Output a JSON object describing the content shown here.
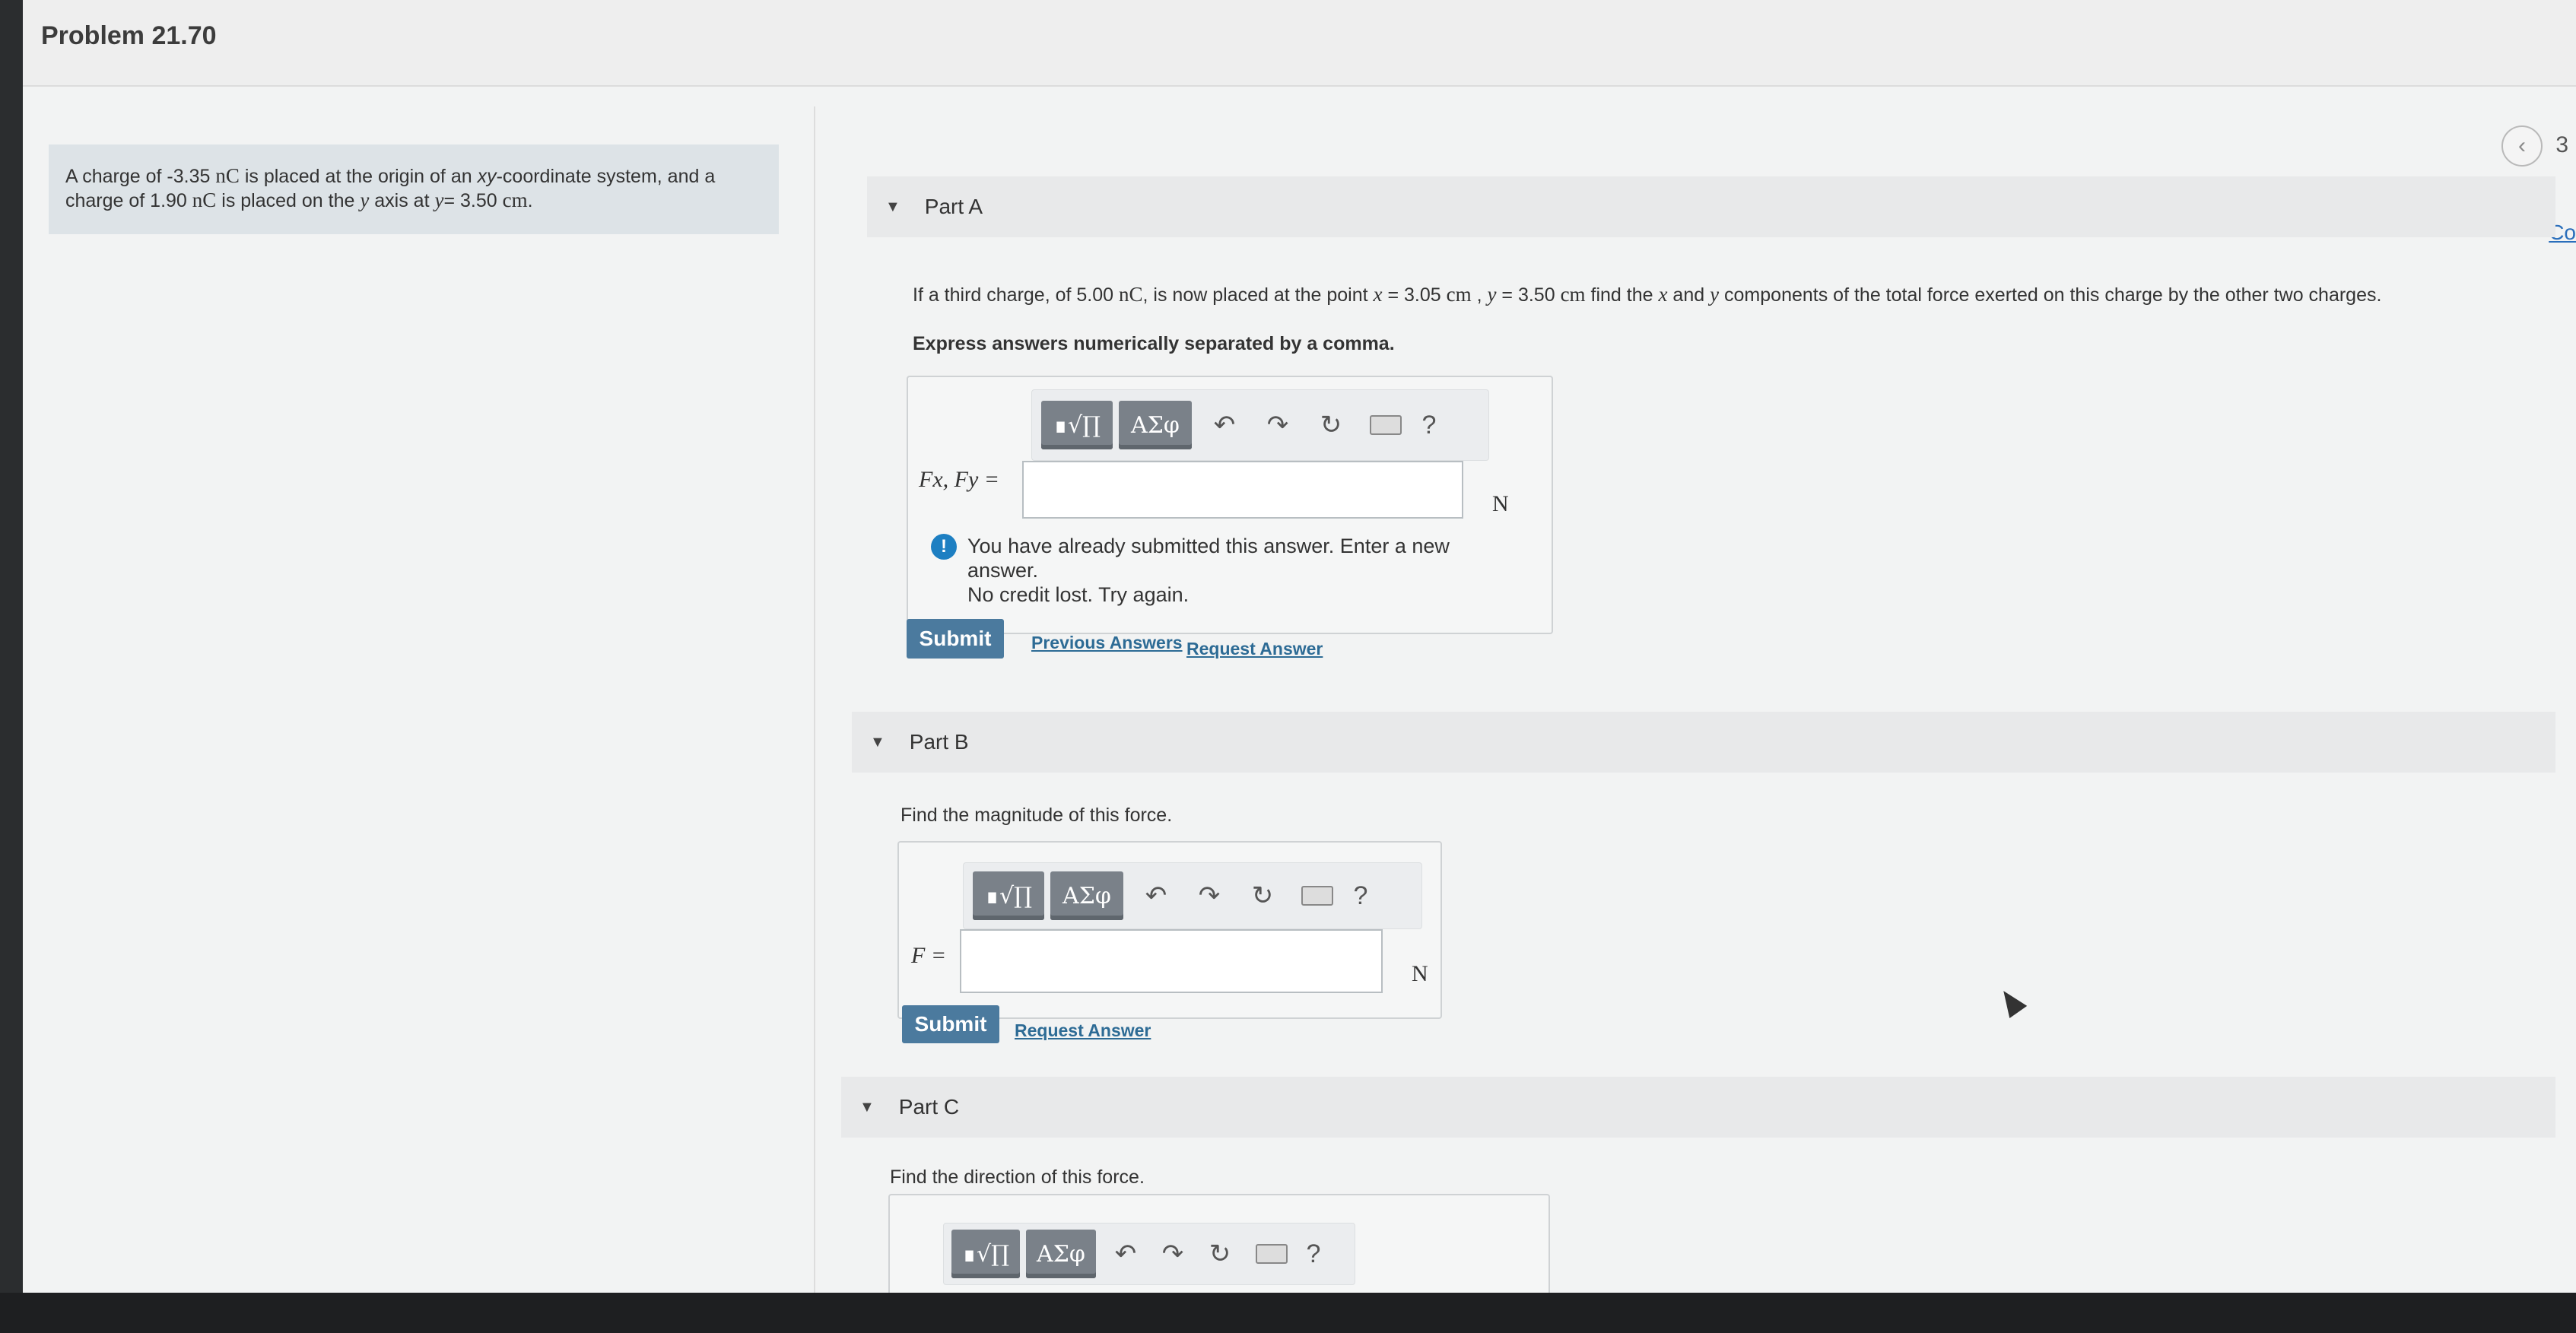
{
  "header": {
    "problem_title": "Problem 21.70"
  },
  "nav": {
    "prev_icon": "chevron-left-icon",
    "page_number": "3",
    "continue_label": "Co"
  },
  "intro": {
    "t1": "A charge of -3.35",
    "unit_nc_1": "nC",
    "t2": "is placed at the origin of an",
    "xy": "xy",
    "t3": "-coordinate system, and a charge of 1.90",
    "unit_nc_2": "nC",
    "t4": "is placed on the",
    "y": "y",
    "t5": "axis at",
    "y_eq": "y",
    "t6": "= 3.50",
    "unit_cm": "cm",
    "t7": "."
  },
  "part_a": {
    "title": "Part A",
    "q1": "If a third charge, of 5.00",
    "q_unit_nc": "nC",
    "q2": ", is now placed at the point",
    "q_x": "x",
    "q3": "= 3.05",
    "q_unit_cm1": "cm",
    "q4": ",",
    "q_y": "y",
    "q5": "= 3.50",
    "q_unit_cm2": "cm",
    "q6": "find the",
    "q_x2": "x",
    "q7": "and",
    "q_y2": "y",
    "q8": "components of the total force exerted on this charge by the other two charges.",
    "instruction": "Express answers numerically separated by a comma.",
    "eq_label": "Fx, Fy =",
    "input_value": "",
    "unit": "N",
    "alert_line1": "You have already submitted this answer. Enter a new answer.",
    "alert_line2": "No credit lost. Try again.",
    "alert_icon": "!",
    "submit": "Submit",
    "previous_answers": "Previous Answers",
    "request_answer": "Request Answer"
  },
  "part_b": {
    "title": "Part B",
    "question": "Find the magnitude of this force.",
    "eq_label": "F =",
    "input_value": "",
    "unit": "N",
    "submit": "Submit",
    "request_answer": "Request Answer"
  },
  "part_c": {
    "title": "Part C",
    "question": "Find the direction of this force."
  },
  "toolbar": {
    "templates": "∎√∏",
    "symbols": "ΑΣφ",
    "undo": "↶",
    "redo": "↷",
    "reset": "↻",
    "help": "?"
  }
}
